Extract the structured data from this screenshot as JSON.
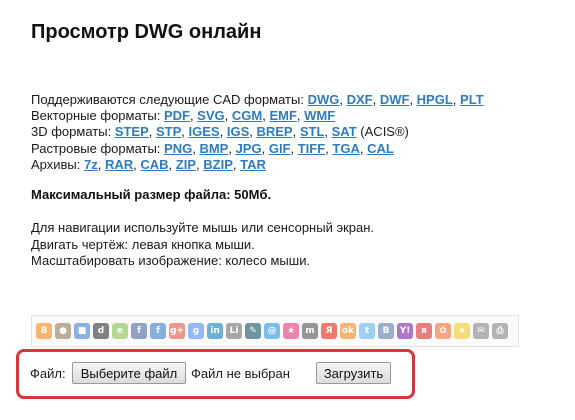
{
  "page": {
    "title": "Просмотр DWG онлайн"
  },
  "formats": {
    "cad": {
      "label": "Поддерживаются следующие CAD форматы: ",
      "items": [
        "DWG",
        "DXF",
        "DWF",
        "HPGL",
        "PLT"
      ]
    },
    "vector": {
      "label": "Векторные форматы: ",
      "items": [
        "PDF",
        "SVG",
        "CGM",
        "EMF",
        "WMF"
      ]
    },
    "three_d": {
      "label": "3D форматы: ",
      "items": [
        "STEP",
        "STP",
        "IGES",
        "IGS",
        "BREP",
        "STL",
        "SAT"
      ],
      "suffix": " (ACIS®)"
    },
    "raster": {
      "label": "Растровые форматы: ",
      "items": [
        "PNG",
        "BMP",
        "JPG",
        "GIF",
        "TIFF",
        "TGA",
        "CAL"
      ]
    },
    "archives": {
      "label": "Архивы: ",
      "items": [
        "7z",
        "RAR",
        "CAB",
        "ZIP",
        "BZIP",
        "TAR"
      ]
    }
  },
  "max_size": "Максимальный размер файла: 50Мб.",
  "help": {
    "line1": "Для навигации используйте мышь или сенсорный экран.",
    "line2": "Двигать чертёж: левая кнопка мыши.",
    "line3": "Масштабировать изображение: колесо мыши."
  },
  "share_icons": [
    {
      "name": "blogger-icon",
      "glyph": "B",
      "color": "#f57d00"
    },
    {
      "name": "bobrdobr-icon",
      "glyph": "●",
      "color": "#8a6d4b"
    },
    {
      "name": "delicious-icon",
      "glyph": "■",
      "color": "#3274d1"
    },
    {
      "name": "digg-icon",
      "glyph": "d",
      "color": "#1d1d1d"
    },
    {
      "name": "evernote-icon",
      "glyph": "e",
      "color": "#7ac142"
    },
    {
      "name": "facebook-icon",
      "glyph": "f",
      "color": "#3b5998"
    },
    {
      "name": "friendfeed-icon",
      "glyph": "f",
      "color": "#2f72c4"
    },
    {
      "name": "googleplus-icon",
      "glyph": "g+",
      "color": "#dd4b39"
    },
    {
      "name": "google-bookmarks-icon",
      "glyph": "g",
      "color": "#4285f4"
    },
    {
      "name": "linkedin-icon",
      "glyph": "in",
      "color": "#0077b5"
    },
    {
      "name": "liveinternet-icon",
      "glyph": "Li",
      "color": "#666666"
    },
    {
      "name": "livejournal-icon",
      "glyph": "✎",
      "color": "#004359"
    },
    {
      "name": "mail-icon",
      "glyph": "@",
      "color": "#168de2"
    },
    {
      "name": "memori-icon",
      "glyph": "★",
      "color": "#e2246f"
    },
    {
      "name": "myspace-icon",
      "glyph": "m",
      "color": "#444444"
    },
    {
      "name": "yandex-icon",
      "glyph": "Я",
      "color": "#e61400"
    },
    {
      "name": "odnoklassniki-icon",
      "glyph": "ok",
      "color": "#ee8208"
    },
    {
      "name": "twitter-icon",
      "glyph": "t",
      "color": "#55acee"
    },
    {
      "name": "vkontakte-icon",
      "glyph": "B",
      "color": "#4c75a3"
    },
    {
      "name": "yahoo-icon",
      "glyph": "Y!",
      "color": "#720e9e"
    },
    {
      "name": "yaru-icon",
      "glyph": "я",
      "color": "#d91e18"
    },
    {
      "name": "moikrug-icon",
      "glyph": "✿",
      "color": "#f26522"
    },
    {
      "name": "favorites-icon",
      "glyph": "★",
      "color": "#f2c40f"
    },
    {
      "name": "email-icon",
      "glyph": "✉",
      "color": "#7a7a7a"
    },
    {
      "name": "print-icon",
      "glyph": "⎙",
      "color": "#7a7a7a"
    }
  ],
  "upload": {
    "file_label": "Файл:",
    "choose_button": "Выберите файл",
    "no_file_text": "Файл не выбран",
    "upload_button": "Загрузить"
  },
  "colors": {
    "link": "#2f7bbf",
    "frame_highlight": "#d9363a"
  }
}
